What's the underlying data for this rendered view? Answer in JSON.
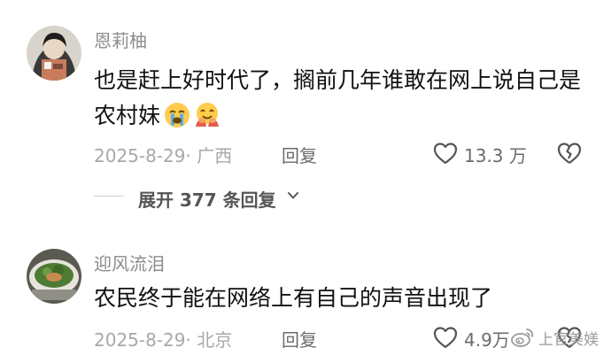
{
  "comments": [
    {
      "username": "恩莉柚",
      "text": "也是赶上好时代了，搁前几年谁敢在网上说自己是农村妹",
      "emojis": [
        "crying-face-icon",
        "hugging-face-icon"
      ],
      "date": "2025-8-29",
      "location": "广西",
      "meta": "2025-8-29· 广西",
      "reply_label": "回复",
      "likes": "13.3 万",
      "expand_label": "展开 377 条回复"
    },
    {
      "username": "迎风流泪",
      "text": "农民终于能在网络上有自己的声音出现了",
      "date": "2025-8-29",
      "location": "北京",
      "meta": "2025-8-29· 北京",
      "reply_label": "回复",
      "likes": "4.9万"
    }
  ],
  "watermark": {
    "text": "上官美媄",
    "icon": "weibo-logo-icon"
  }
}
